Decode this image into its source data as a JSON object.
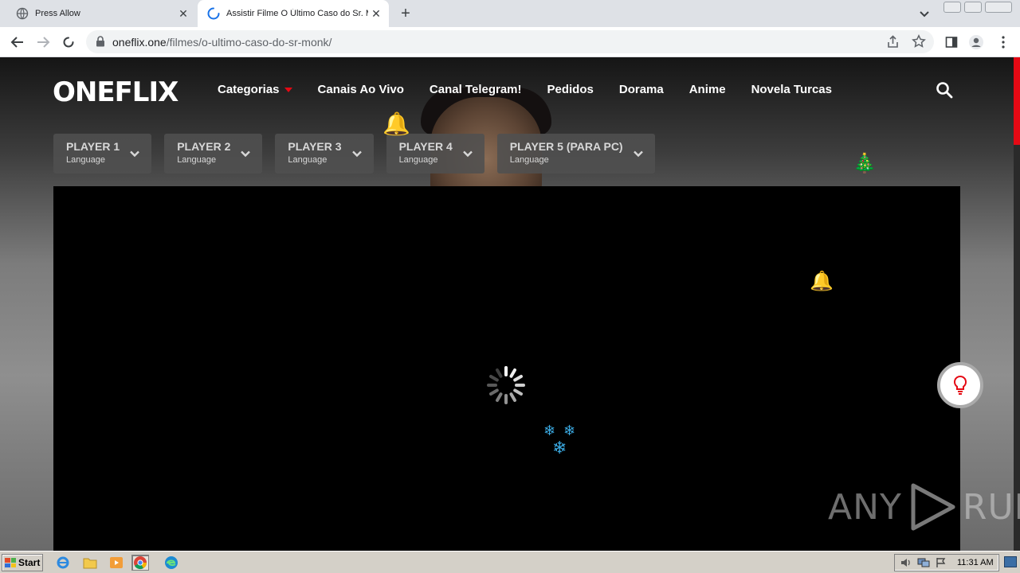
{
  "browser": {
    "tabs": [
      {
        "title": "Press Allow",
        "state": "inactive",
        "icon": "globe-icon"
      },
      {
        "title": "Assistir Filme O Último Caso do Sr. M",
        "state": "active-loading",
        "icon": "loading-spinner-icon"
      }
    ],
    "new_tab": "+",
    "url_domain": "oneflix.one",
    "url_path": "/filmes/o-ultimo-caso-do-sr-monk/"
  },
  "site": {
    "logo": "ONEFLIX",
    "nav": [
      {
        "label": "Categorias",
        "has_caret": true
      },
      {
        "label": "Canais Ao Vivo"
      },
      {
        "label": "Canal Telegram!"
      },
      {
        "label": "Pedidos"
      },
      {
        "label": "Dorama"
      },
      {
        "label": "Anime"
      },
      {
        "label": "Novela Turcas"
      }
    ],
    "players": [
      {
        "title": "PLAYER 1",
        "sub": "Language"
      },
      {
        "title": "PLAYER 2",
        "sub": "Language"
      },
      {
        "title": "PLAYER 3",
        "sub": "Language"
      },
      {
        "title": "PLAYER 4",
        "sub": "Language"
      },
      {
        "title": "PLAYER 5 (PARA PC)",
        "sub": "Language"
      }
    ],
    "video": {
      "state": "loading"
    },
    "watermark": {
      "left": "ANY",
      "right": "RUN"
    },
    "accent_color": "#e50914"
  },
  "decorations": {
    "bell": "🔔",
    "ornament": "🎄",
    "snowflake": "❄"
  },
  "taskbar": {
    "start_label": "Start",
    "clock": "11:31 AM"
  }
}
